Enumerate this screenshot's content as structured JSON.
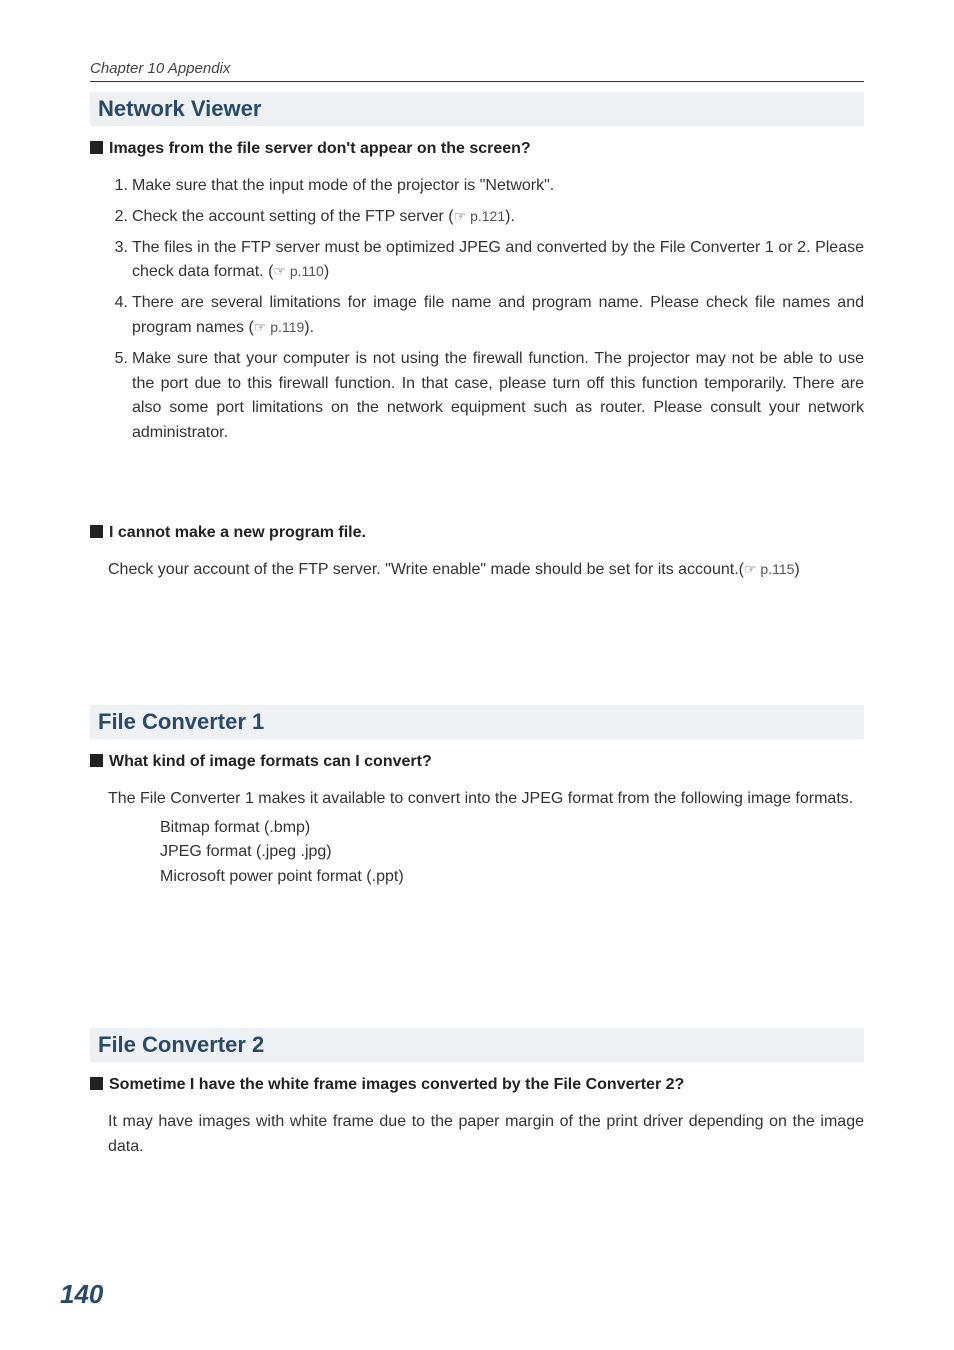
{
  "header": {
    "chapter": "Chapter 10 Appendix"
  },
  "sec1": {
    "title": "Network Viewer",
    "q1": "Images from the file server don't appear on the screen?",
    "items": {
      "n1": "1.",
      "t1": "Make sure that the input mode of the projector is \"Network\".",
      "n2": "2.",
      "t2a": "Check the account setting of the FTP server (",
      "t2ref": "☞ p.121",
      "t2b": ").",
      "n3": "3.",
      "t3a": "The files in the FTP server must be optimized JPEG and converted  by the File Converter 1 or 2. Please check data format. (",
      "t3ref": "☞ p.110",
      "t3b": ")",
      "n4": "4.",
      "t4a": "There are several limitations for image file name and program name. Please check file names and program names (",
      "t4ref": "☞ p.119",
      "t4b": ").",
      "n5": "5.",
      "t5": "Make sure that your computer is not using the firewall function. The projector may not be able to use the port due to this firewall function. In that case, please turn off this function temporarily. There are also some port limitations on the network equipment such as router. Please consult your network administrator."
    },
    "q2": "I cannot make a new program file.",
    "a2a": "Check your account of the FTP server. \"Write enable\"  made should be set for its account.(",
    "a2ref": "☞ p.115",
    "a2b": ")"
  },
  "sec2": {
    "title": "File Converter 1",
    "q1": "What kind of image formats can I convert?",
    "intro": "The File Converter 1 makes it available to convert into the JPEG format from the following image formats.",
    "f1": "Bitmap format (.bmp)",
    "f2": "JPEG format (.jpeg .jpg)",
    "f3": "Microsoft power point format (.ppt)"
  },
  "sec3": {
    "title": "File Converter 2",
    "q1": "Sometime I have the white frame images converted by the File Converter 2?",
    "a1": "It may have images with white frame due to the paper margin of the print driver depending on the image data."
  },
  "page_number": "140"
}
